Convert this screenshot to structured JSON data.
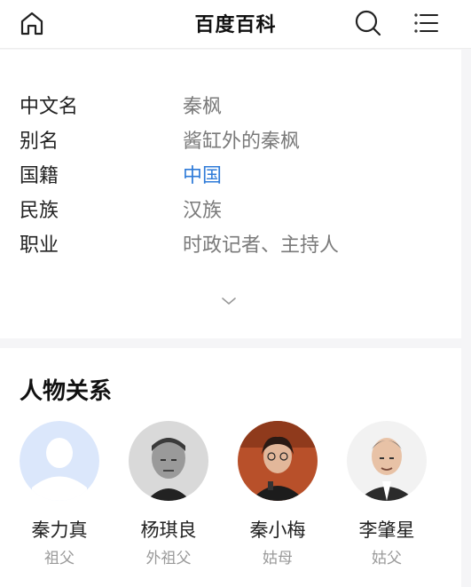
{
  "header": {
    "title": "百度百科",
    "icons": [
      "home-icon",
      "search-icon",
      "menu-icon"
    ]
  },
  "info": {
    "rows": [
      {
        "key": "中文名",
        "value": "秦枫"
      },
      {
        "key": "别名",
        "value": "酱缸外的秦枫"
      },
      {
        "key": "国籍",
        "value": "中国"
      },
      {
        "key": "民族",
        "value": "汉族"
      },
      {
        "key": "职业",
        "value": "时政记者、主持人"
      }
    ],
    "link_color": "#2f7bd8"
  },
  "relations": {
    "title": "人物关系",
    "people": [
      {
        "name": "秦力真",
        "relation": "祖父",
        "avatar": "placeholder-person-icon"
      },
      {
        "name": "杨琪良",
        "relation": "外祖父",
        "avatar": "portrait-photo"
      },
      {
        "name": "秦小梅",
        "relation": "姑母",
        "avatar": "portrait-photo"
      },
      {
        "name": "李肇星",
        "relation": "姑父",
        "avatar": "portrait-photo"
      }
    ]
  }
}
